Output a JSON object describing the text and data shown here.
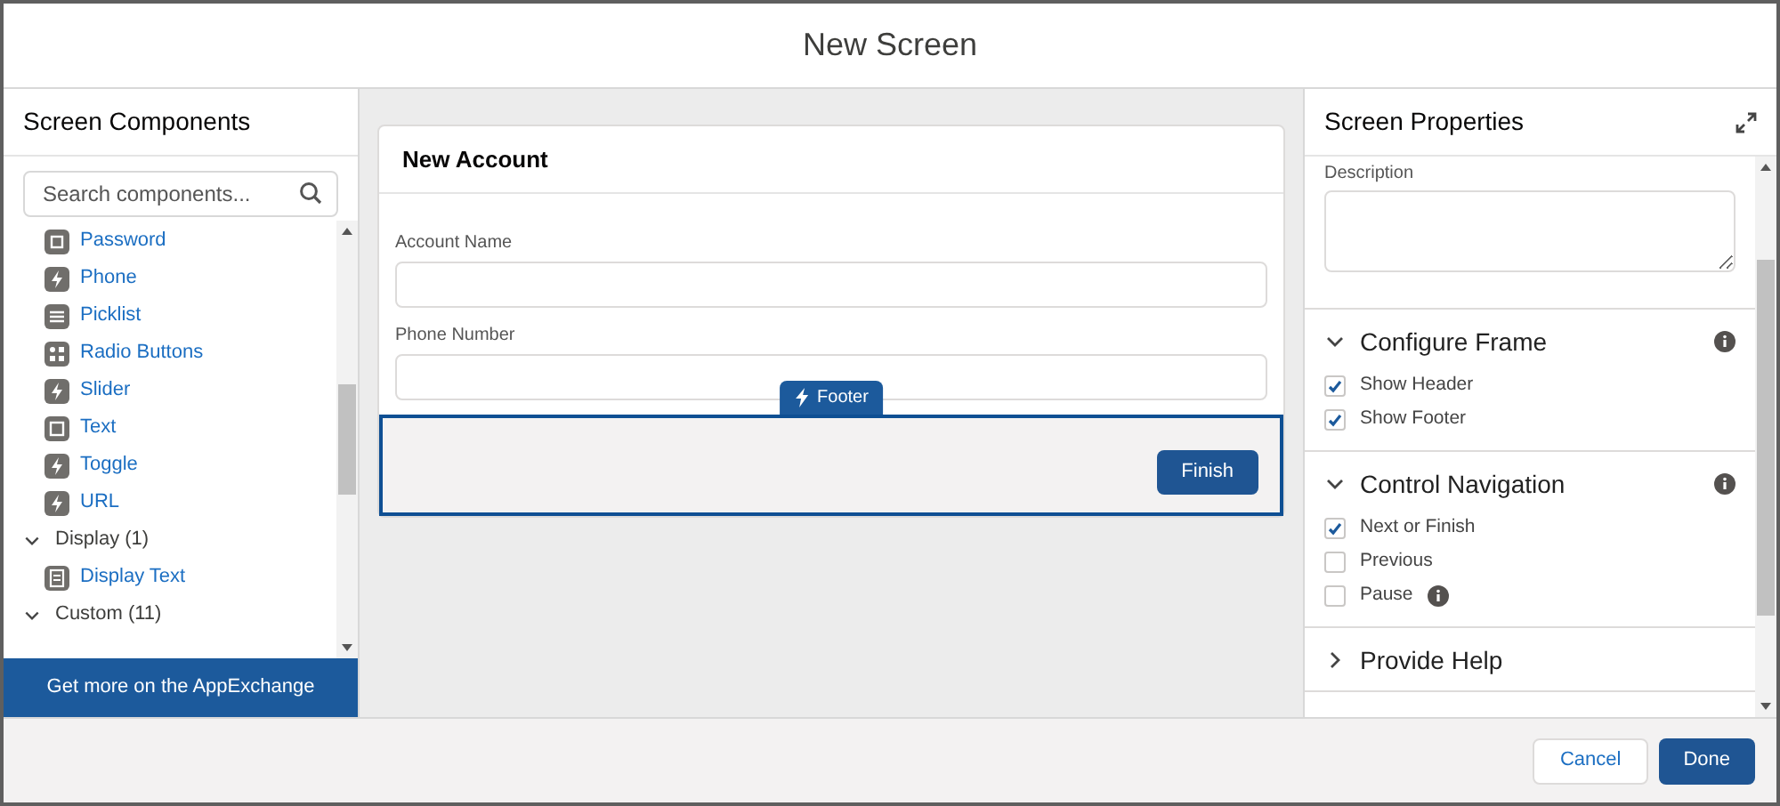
{
  "window": {
    "title": "New Screen"
  },
  "components_panel": {
    "title": "Screen Components",
    "search": {
      "placeholder": "Search components..."
    },
    "items": [
      {
        "kind": "item",
        "label": "Password"
      },
      {
        "kind": "item",
        "label": "Phone"
      },
      {
        "kind": "item",
        "label": "Picklist"
      },
      {
        "kind": "item",
        "label": "Radio Buttons"
      },
      {
        "kind": "item",
        "label": "Slider"
      },
      {
        "kind": "item",
        "label": "Text"
      },
      {
        "kind": "item",
        "label": "Toggle"
      },
      {
        "kind": "item",
        "label": "URL"
      },
      {
        "kind": "group",
        "label": "Display (1)",
        "expanded": true
      },
      {
        "kind": "item",
        "label": "Display Text"
      },
      {
        "kind": "group",
        "label": "Custom (11)",
        "expanded": true
      }
    ],
    "appexchange": "Get more on the AppExchange"
  },
  "canvas": {
    "title": "New Account",
    "fields": [
      {
        "label": "Account Name"
      },
      {
        "label": "Phone Number"
      }
    ],
    "footer": {
      "tag": "Footer",
      "selected": true,
      "button": "Finish"
    }
  },
  "properties_panel": {
    "title": "Screen Properties",
    "description_label": "Description",
    "sections": [
      {
        "title": "Configure Frame",
        "expanded": true,
        "info": true,
        "options": [
          {
            "label": "Show Header",
            "checked": true,
            "info": false
          },
          {
            "label": "Show Footer",
            "checked": true,
            "info": false
          }
        ]
      },
      {
        "title": "Control Navigation",
        "expanded": true,
        "info": true,
        "options": [
          {
            "label": "Next or Finish",
            "checked": true,
            "info": false
          },
          {
            "label": "Previous",
            "checked": false,
            "info": false
          },
          {
            "label": "Pause",
            "checked": false,
            "info": true
          }
        ]
      },
      {
        "title": "Provide Help",
        "expanded": false,
        "info": false
      }
    ]
  },
  "buttons": [
    {
      "label": "Cancel",
      "kind": "neutral"
    },
    {
      "label": "Done",
      "kind": "brand"
    }
  ]
}
